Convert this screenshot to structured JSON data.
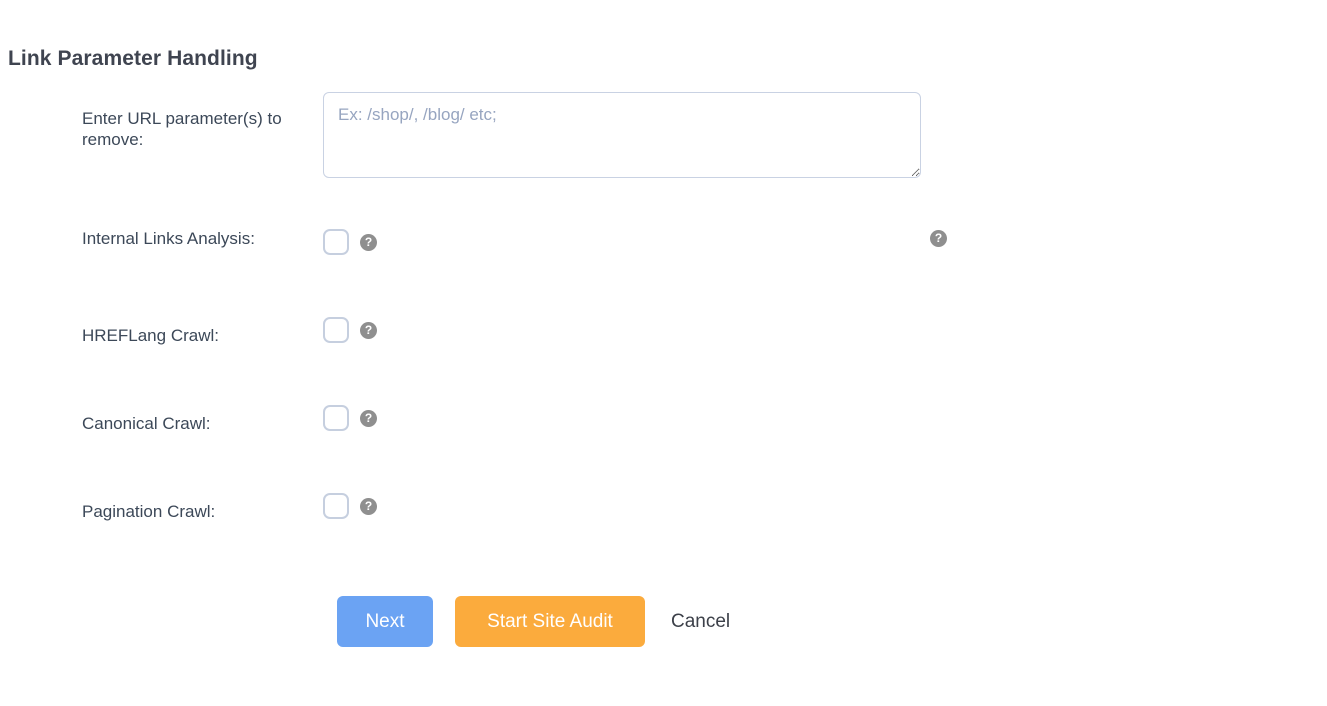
{
  "page": {
    "title": "Link Parameter Handling"
  },
  "form": {
    "url_parameters": {
      "label": "Enter URL parameter(s) to remove:",
      "placeholder": "Ex: /shop/, /blog/ etc;",
      "value": "",
      "help_icon": "help-circle-icon",
      "help_label": "?"
    },
    "internal_links": {
      "label": "Internal Links Analysis:",
      "checked": false,
      "help_label": "?"
    },
    "hreflang_crawl": {
      "label": "HREFLang Crawl:",
      "checked": false,
      "help_label": "?"
    },
    "canonical_crawl": {
      "label": "Canonical Crawl:",
      "checked": false,
      "help_label": "?"
    },
    "pagination_crawl": {
      "label": "Pagination Crawl:",
      "checked": false,
      "help_label": "?"
    }
  },
  "actions": {
    "next_label": "Next",
    "start_audit_label": "Start Site Audit",
    "cancel_label": "Cancel"
  },
  "colors": {
    "next_button": "#6ba3f3",
    "start_audit_button": "#fbab3d",
    "label_text": "#3c4858",
    "placeholder_text": "#97a5c0",
    "checkbox_border": "#c6cfdf",
    "help_icon": "#8f8f8f",
    "background": "#ffffff"
  }
}
